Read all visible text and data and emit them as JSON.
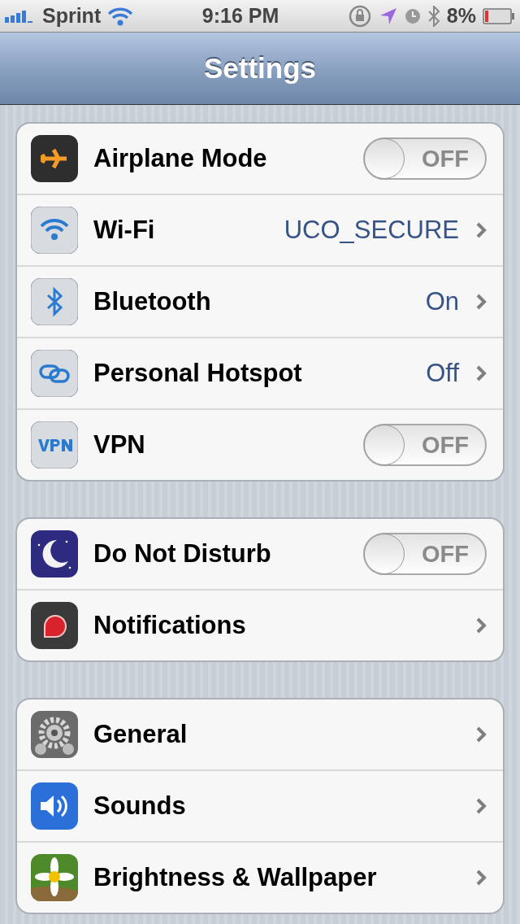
{
  "status_bar": {
    "carrier": "Sprint",
    "time": "9:16 PM",
    "battery": "8%"
  },
  "nav_bar": {
    "title": "Settings"
  },
  "groups": [
    {
      "items": [
        {
          "label": "Airplane Mode",
          "kind": "toggle",
          "on": false,
          "state_label": "OFF"
        },
        {
          "label": "Wi-Fi",
          "kind": "link",
          "value": "UCO_SECURE"
        },
        {
          "label": "Bluetooth",
          "kind": "link",
          "value": "On"
        },
        {
          "label": "Personal Hotspot",
          "kind": "link",
          "value": "Off"
        },
        {
          "label": "VPN",
          "kind": "toggle",
          "on": false,
          "state_label": "OFF"
        }
      ]
    },
    {
      "items": [
        {
          "label": "Do Not Disturb",
          "kind": "toggle",
          "on": false,
          "state_label": "OFF"
        },
        {
          "label": "Notifications",
          "kind": "link"
        }
      ]
    },
    {
      "items": [
        {
          "label": "General",
          "kind": "link"
        },
        {
          "label": "Sounds",
          "kind": "link"
        },
        {
          "label": "Brightness & Wallpaper",
          "kind": "link"
        }
      ]
    }
  ]
}
